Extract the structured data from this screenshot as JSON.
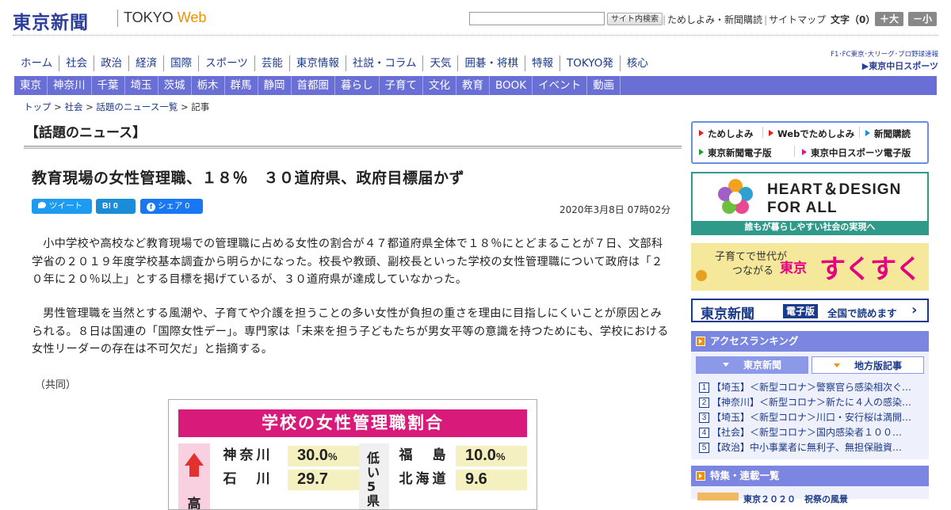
{
  "header": {
    "logo": "東京新聞",
    "site_name_a": "TOKYO ",
    "site_name_b": "Web",
    "search_button": "サイト内検索",
    "links": [
      "ためしよみ・新聞購読",
      "サイトマップ"
    ],
    "font_size_label": "文字（0）",
    "font_plus": "＋大",
    "font_minus": "－小"
  },
  "nav_main": [
    "ホーム",
    "社会",
    "政治",
    "経済",
    "国際",
    "スポーツ",
    "芸能",
    "東京情報",
    "社説・コラム",
    "天気",
    "囲碁・将棋",
    "特報",
    "TOKYO発",
    "核心"
  ],
  "nav_chunichi": {
    "top": "F1･FC東京･大リーグ･プロ野球速報",
    "bottom": "▶東京中日スポーツ"
  },
  "nav_region": [
    "東京",
    "神奈川",
    "千葉",
    "埼玉",
    "茨城",
    "栃木",
    "群馬",
    "静岡",
    "首都圏",
    "暮らし",
    "子育て",
    "文化",
    "教育",
    "BOOK",
    "イベント",
    "動画"
  ],
  "breadcrumb": {
    "items": [
      "トップ",
      "社会",
      "話題のニュース一覧"
    ],
    "current": "記事",
    "sep": " > "
  },
  "article": {
    "section": "【話題のニュース】",
    "headline": "教育現場の女性管理職、１８％　３０道府県、政府目標届かず",
    "share_tweet": "ツイート",
    "share_hatena": "B! 0",
    "share_facebook": "シェア 0",
    "date": "2020年3月8日 07時02分",
    "paragraphs": [
      "小中学校や高校など教育現場での管理職に占める女性の割合が４７都道府県全体で１８％にとどまることが７日、文部科学省の２０１９年度学校基本調査から明らかになった。校長や教頭、副校長といった学校の女性管理職について政府は「２０年に２０％以上」とする目標を掲げているが、３０道府県が達成していなかった。",
      "男性管理職を当然とする風潮や、子育てや介護を担うことの多い女性が負担の重さを理由に目指しにくいことが原因とみられる。８日は国連の「国際女性デー」。専門家は「未来を担う子どもたちが男女平等の意識を持つためにも、学校における女性リーダーの存在は不可欠だ」と指摘する。"
    ],
    "credit": "（共同）"
  },
  "infographic": {
    "title": "学校の女性管理職割合",
    "high_label": "高",
    "low_label": "低い5県",
    "high": [
      {
        "pref": "神奈川",
        "value": "30.0",
        "unit": "%"
      },
      {
        "pref": "石　川",
        "value": "29.7",
        "unit": ""
      }
    ],
    "low": [
      {
        "pref": "福　島",
        "value": "10.0",
        "unit": "%"
      },
      {
        "pref": "北海道",
        "value": "9.6",
        "unit": ""
      }
    ]
  },
  "sidebar": {
    "promo": [
      "ためしよみ",
      "Webでためしよみ",
      "新聞購読",
      "東京新聞電子版",
      "東京中日スポーツ電子版"
    ],
    "heart": {
      "line1": "HEART＆DESIGN",
      "line2": "FOR ALL",
      "footer": "誰もが暮らしやすい社会の実現へ"
    },
    "sukusuku": {
      "small1": "子育てで世代が",
      "small2": "つながる",
      "tokyo": "東京",
      "big": "すくすく"
    },
    "denshi": {
      "logo": "東京新聞",
      "badge": "電子版",
      "text": "全国で読めます"
    },
    "ranking": {
      "title": "アクセスランキング",
      "tab_active": "東京新聞",
      "tab_inactive": "地方版記事",
      "items": [
        "【埼玉】＜新型コロナ＞警察官ら感染相次ぐ…",
        "【神奈川】＜新型コロナ＞新たに４人の感染…",
        "【埼玉】＜新型コロナ＞川口・安行桜は満開…",
        "【社会】＜新型コロナ＞国内感染者１００…",
        "【政治】中小事業者に無利子、無担保融資…"
      ]
    },
    "feature": {
      "title": "特集・連載一覧",
      "item": "東京２０２０　祝祭の風景"
    }
  },
  "colors": {
    "brand": "#2c3e9a",
    "nav_region_bg": "#6a6fd6",
    "accent_orange": "#f29100",
    "infographic_magenta": "#d81b7a"
  }
}
